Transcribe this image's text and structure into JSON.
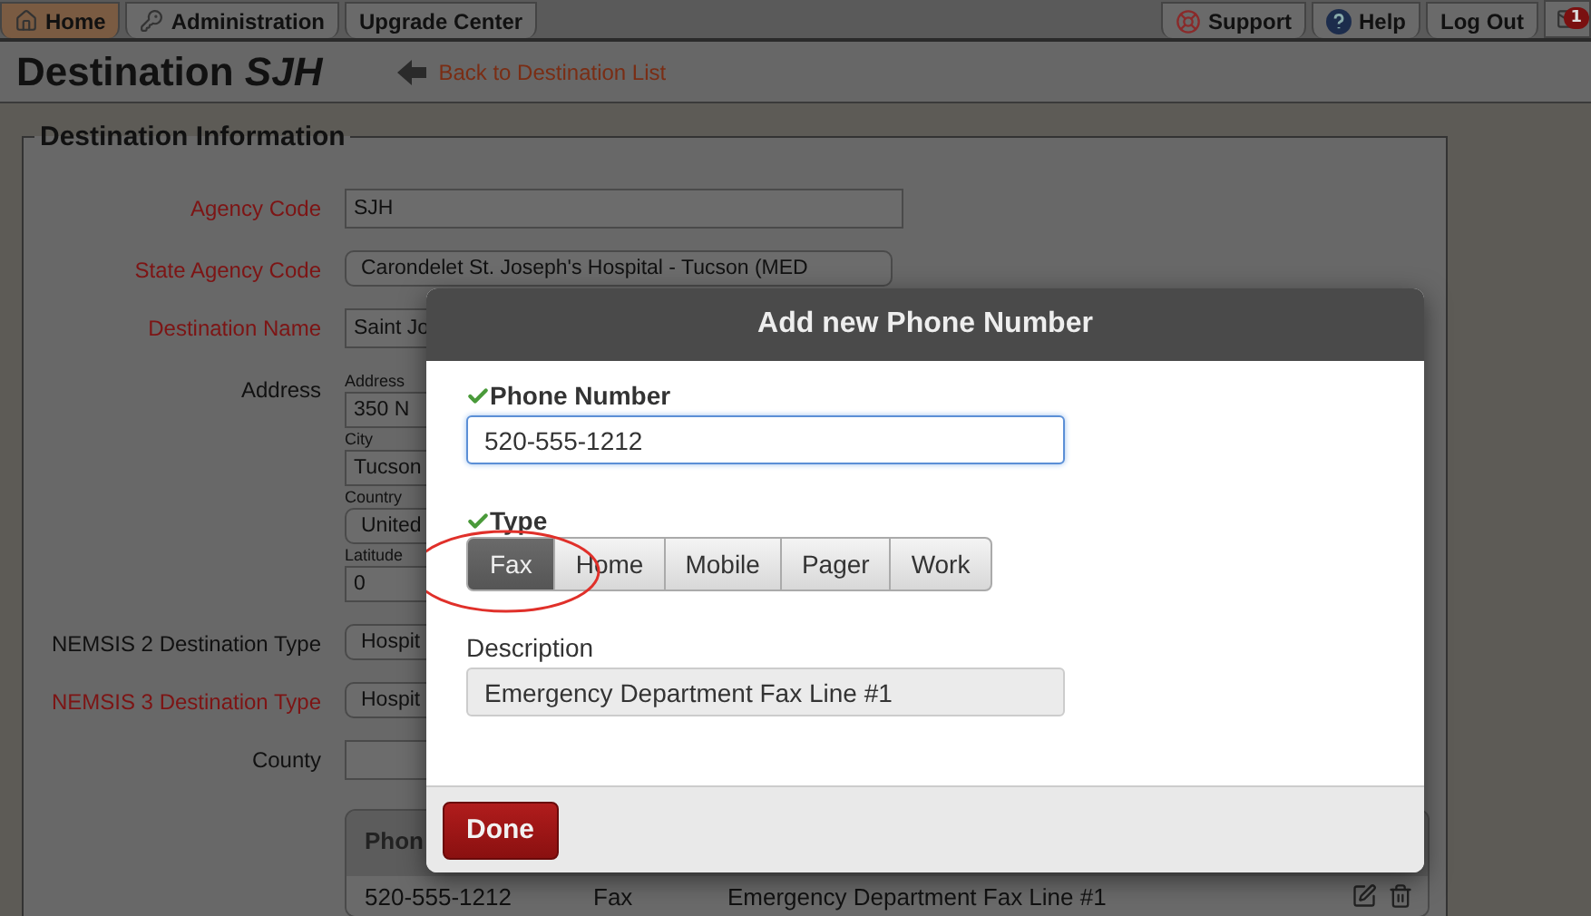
{
  "nav": {
    "left_tabs": [
      {
        "label": "Home",
        "selected": true,
        "kind": "home"
      },
      {
        "label": "Administration",
        "selected": false,
        "kind": "keys"
      },
      {
        "label": "Upgrade Center",
        "selected": false,
        "kind": "none"
      }
    ],
    "right_tabs": [
      {
        "label": "Support",
        "kind": "lifebuoy"
      },
      {
        "label": "Help",
        "kind": "help"
      },
      {
        "label": "Log Out",
        "kind": "none"
      }
    ],
    "notification_count": "1"
  },
  "page_header": {
    "title": "Destination *SJH*",
    "back_link": "Back to Destination List"
  },
  "panel": {
    "legend": "Destination Information",
    "fields": [
      {
        "label": "Agency Code",
        "required": true,
        "kind": "input",
        "value": "SJH"
      },
      {
        "label": "State Agency Code",
        "required": true,
        "kind": "select",
        "value": "Carondelet St. Joseph's Hospital - Tucson (MED"
      },
      {
        "label": "Destination Name",
        "required": true,
        "kind": "input",
        "value": "Saint Jo"
      },
      {
        "label": "Address",
        "required": false,
        "kind": "address",
        "parts": [
          {
            "label": "Address",
            "kind": "input",
            "value": "350 N"
          },
          {
            "label": "City",
            "kind": "input",
            "value": "Tucson"
          },
          {
            "label": "Country",
            "kind": "select",
            "value": "United"
          },
          {
            "label": "Latitude",
            "kind": "input",
            "value": "0"
          }
        ]
      },
      {
        "label": "NEMSIS 2 Destination Type",
        "required": false,
        "kind": "select",
        "value": "Hospit"
      },
      {
        "label": "NEMSIS 3 Destination Type",
        "required": true,
        "kind": "select",
        "value": "Hospit"
      },
      {
        "label": "County",
        "required": false,
        "kind": "input"
      }
    ],
    "phones": {
      "header": "Phon",
      "rows": [
        {
          "number": "520-555-1212",
          "type": "Fax",
          "description": "Emergency Department Fax Line #1"
        }
      ]
    }
  },
  "modal": {
    "title": "Add new Phone Number",
    "phone_label": "Phone Number",
    "phone_valid": true,
    "phone_value": "520-555-1212",
    "type_label": "Type",
    "type_valid": true,
    "types": [
      {
        "label": "Fax",
        "selected": true
      },
      {
        "label": "Home",
        "selected": false
      },
      {
        "label": "Mobile",
        "selected": false
      },
      {
        "label": "Pager",
        "selected": false
      },
      {
        "label": "Work",
        "selected": false
      }
    ],
    "description_label": "Description",
    "description_value": "Emergency Department Fax Line #1",
    "done": "Done"
  }
}
